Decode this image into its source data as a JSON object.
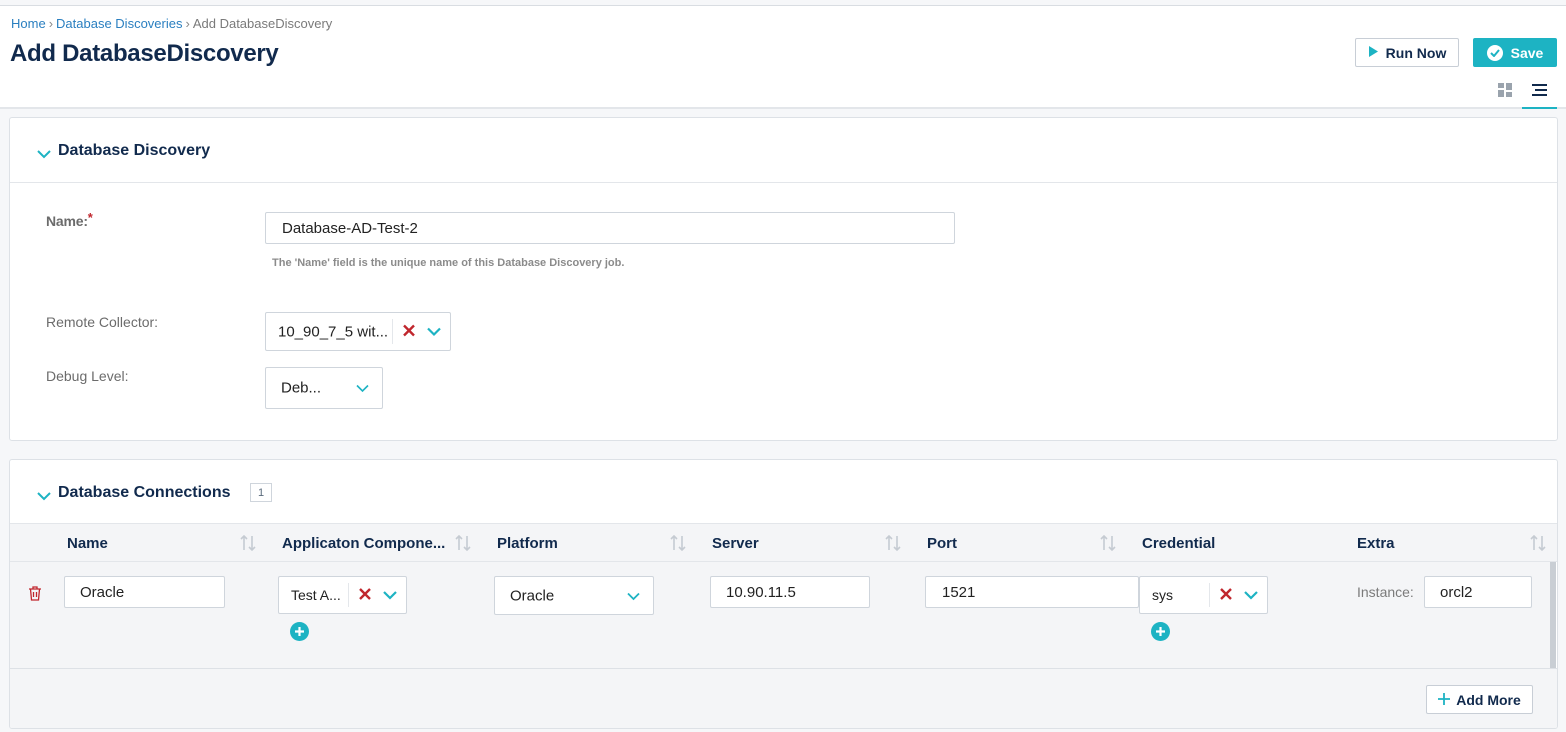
{
  "breadcrumb": {
    "home": "Home",
    "parent": "Database Discoveries",
    "current": "Add DatabaseDiscovery",
    "separator": "›"
  },
  "page_title": "Add DatabaseDiscovery",
  "toolbar": {
    "run_now": "Run Now",
    "save": "Save",
    "view_grid_icon": "grid-view-icon",
    "view_list_icon": "list-view-icon"
  },
  "section_discovery": {
    "title": "Database Discovery",
    "name_label": "Name:",
    "required_mark": "*",
    "name_value": "Database-AD-Test-2",
    "name_hint": "The 'Name' field is the unique name of this Database Discovery job.",
    "remote_collector_label": "Remote Collector:",
    "remote_collector_value": "10_90_7_5 wit...",
    "debug_level_label": "Debug Level:",
    "debug_level_value": "Deb..."
  },
  "section_connections": {
    "title": "Database Connections",
    "count": "1",
    "columns": [
      "Name",
      "Applicaton Compone...",
      "Platform",
      "Server",
      "Port",
      "Credential",
      "Extra"
    ],
    "rows": [
      {
        "name": "Oracle",
        "application_component": "Test A...",
        "platform": "Oracle",
        "server": "10.90.11.5",
        "port": "1521",
        "credential": "sys",
        "extra_label": "Instance:",
        "extra_value": "orcl2"
      }
    ],
    "add_more": "Add More"
  },
  "colors": {
    "accent": "#1db3c3",
    "title": "#112a4d",
    "link": "#2a7fc0",
    "danger": "#c0262d"
  }
}
